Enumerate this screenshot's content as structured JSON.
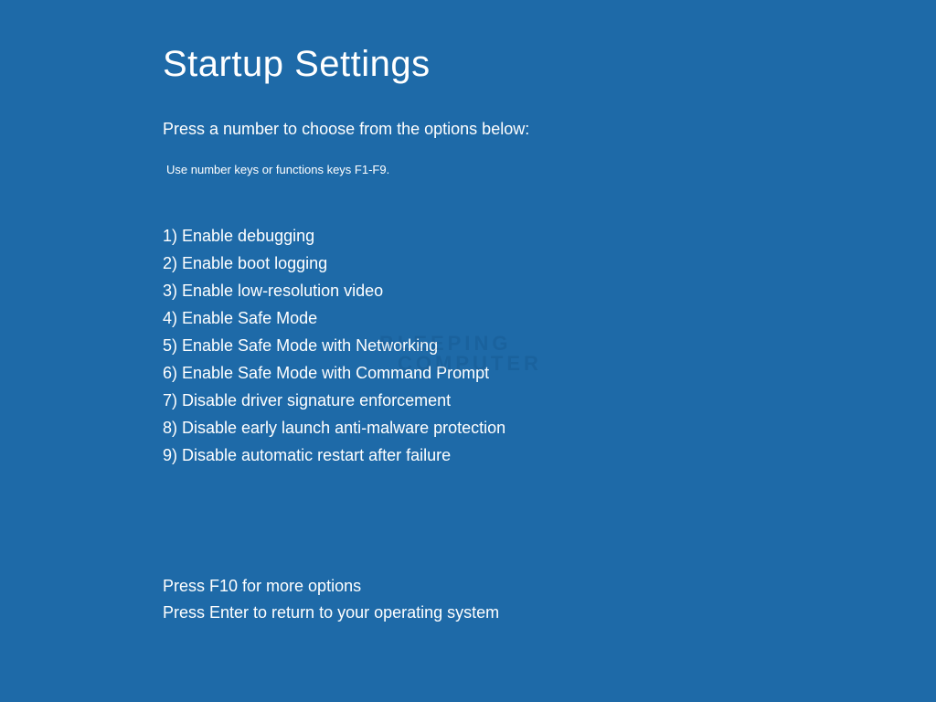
{
  "title": "Startup Settings",
  "instruction": "Press a number to choose from the options below:",
  "sub_instruction": "Use number keys or functions keys F1-F9.",
  "options": [
    "1) Enable debugging",
    "2) Enable boot logging",
    "3) Enable low-resolution video",
    "4) Enable Safe Mode",
    "5) Enable Safe Mode with Networking",
    "6) Enable Safe Mode with Command Prompt",
    "7) Disable driver signature enforcement",
    "8) Disable early launch anti-malware protection",
    "9) Disable automatic restart after failure"
  ],
  "footer": {
    "line1": "Press F10 for more options",
    "line2": "Press Enter to return to your operating system"
  },
  "watermark": {
    "line1": "BLEEPING",
    "line2": "COMPUTER"
  }
}
